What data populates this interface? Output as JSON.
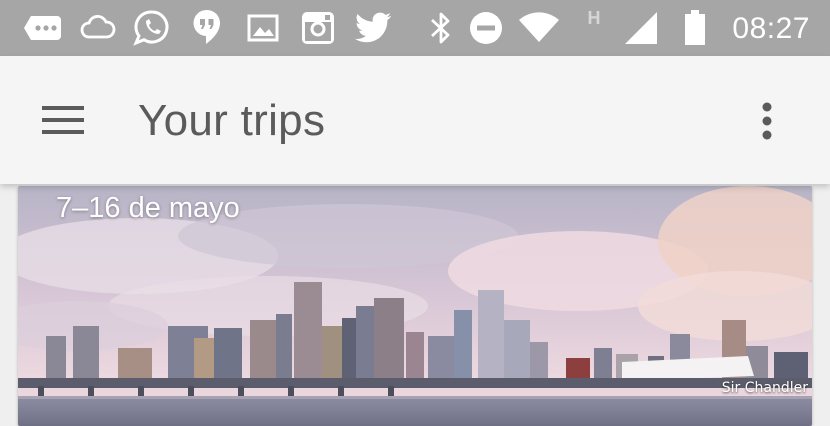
{
  "status_bar": {
    "time": "08:27",
    "left_icons": [
      "more-notifications-icon",
      "cloud-icon",
      "whatsapp-icon",
      "hangouts-icon",
      "image-icon",
      "instagram-icon",
      "twitter-icon"
    ],
    "right_icons": [
      "bluetooth-icon",
      "do-not-disturb-icon",
      "wifi-icon",
      "network-type-icon",
      "cell-signal-icon",
      "battery-icon"
    ],
    "network_type": "H"
  },
  "app_bar": {
    "title": "Your trips",
    "menu_icon": "menu-icon",
    "overflow_icon": "more-vert-icon"
  },
  "trip_card": {
    "dates": "7–16 de mayo",
    "photo_credit": "Sir Chandler"
  },
  "colors": {
    "status_bar_bg": "#a6a6a6",
    "app_bar_bg": "#f5f5f5",
    "title_text": "#5b5b5b",
    "page_bg": "#efefef"
  }
}
